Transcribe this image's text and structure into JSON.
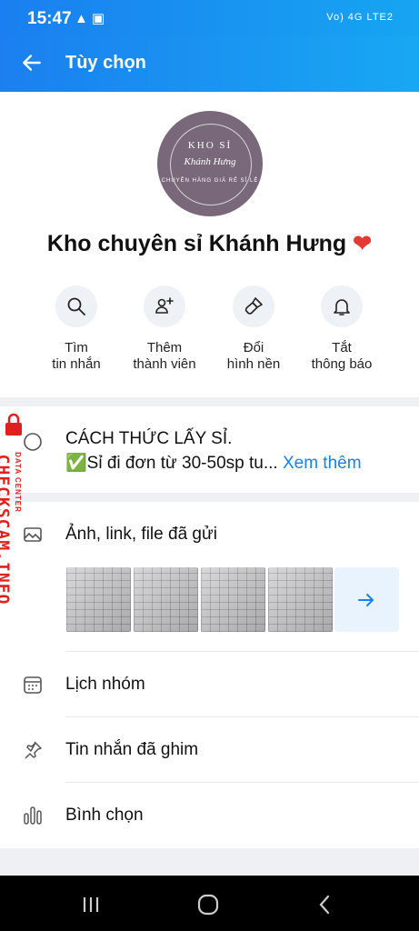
{
  "status": {
    "time": "15:47",
    "network": "Vo) 4G LTE2"
  },
  "appbar": {
    "title": "Tùy chọn"
  },
  "group": {
    "name": "Kho chuyên sỉ Khánh Hưng",
    "avatar_brand": "KHO SỈ",
    "avatar_script": "Khánh Hưng",
    "avatar_slogan": "CHUYÊN HÀNG GIÁ RẺ SỈ LẺ"
  },
  "actions": [
    {
      "line1": "Tìm",
      "line2": "tin nhắn",
      "icon": "search-icon"
    },
    {
      "line1": "Thêm",
      "line2": "thành viên",
      "icon": "add-member-icon"
    },
    {
      "line1": "Đổi",
      "line2": "hình nền",
      "icon": "paint-brush-icon"
    },
    {
      "line1": "Tắt",
      "line2": "thông báo",
      "icon": "bell-icon"
    }
  ],
  "pinned_note": {
    "title": "CÁCH THỨC LẤY SỈ.",
    "preview": "✅Sỉ đi đơn từ 30-50sp tu...",
    "more": "Xem thêm"
  },
  "media": {
    "title": "Ảnh, link, file đã gửi",
    "thumb_count": 4
  },
  "menu": [
    {
      "label": "Lịch nhóm",
      "icon": "calendar-icon"
    },
    {
      "label": "Tin nhắn đã ghim",
      "icon": "pin-icon"
    },
    {
      "label": "Bình chọn",
      "icon": "poll-icon"
    }
  ],
  "watermark": {
    "text": "CHECKSCAM.INFO",
    "sub": "DATA CENTER"
  },
  "colors": {
    "accent": "#1a7ff0",
    "avatar_bg": "#78687a",
    "heart": "#e53935",
    "watermark": "#e02020"
  }
}
